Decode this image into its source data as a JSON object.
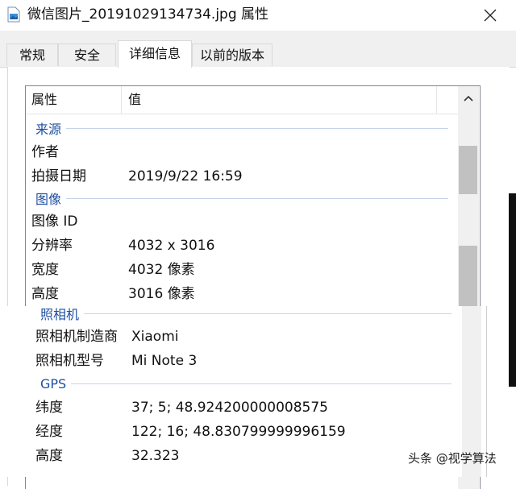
{
  "window": {
    "title": "微信图片_20191029134734.jpg 属性",
    "icon": "image-file-icon",
    "close_icon": "close-icon"
  },
  "tabs": [
    {
      "label": "常规",
      "active": false
    },
    {
      "label": "安全",
      "active": false
    },
    {
      "label": "详细信息",
      "active": true
    },
    {
      "label": "以前的版本",
      "active": false
    }
  ],
  "columns": {
    "property": "属性",
    "value": "值"
  },
  "groups_top": [
    {
      "name": "来源",
      "rows": [
        {
          "label": "作者",
          "value": ""
        },
        {
          "label": "拍摄日期",
          "value": "2019/9/22 16:59"
        }
      ]
    },
    {
      "name": "图像",
      "rows": [
        {
          "label": "图像 ID",
          "value": ""
        },
        {
          "label": "分辨率",
          "value": "4032 x 3016"
        },
        {
          "label": "宽度",
          "value": "4032 像素"
        },
        {
          "label": "高度",
          "value": "3016 像素"
        }
      ]
    }
  ],
  "groups_bottom": [
    {
      "name": "照相机",
      "rows": [
        {
          "label": "照相机制造商",
          "value": "Xiaomi"
        },
        {
          "label": "照相机型号",
          "value": "Mi Note 3"
        }
      ]
    },
    {
      "name": "GPS",
      "rows": [
        {
          "label": "纬度",
          "value": "37; 5; 48.924200000008575"
        },
        {
          "label": "经度",
          "value": "122; 16; 48.830799999996159"
        },
        {
          "label": "高度",
          "value": "32.323"
        }
      ]
    }
  ],
  "watermark": "头条 @视学算法",
  "colors": {
    "group_heading": "#1e4fa0",
    "tab_strip": "#f0f0f0",
    "scroll_thumb": "#c1c1c1"
  }
}
